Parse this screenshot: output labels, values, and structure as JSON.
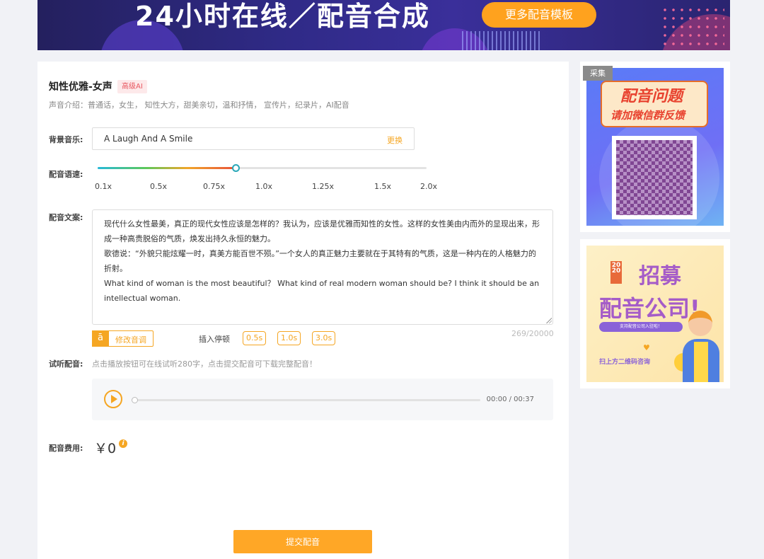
{
  "banner": {
    "title": "24小时在线／配音合成",
    "button": "更多配音模板"
  },
  "voice": {
    "name": "知性优雅-女声",
    "badge": "高级AI",
    "intro": "声音介绍：普通话，女生， 知性大方，甜美亲切，温和抒情， 宣传片，纪录片，AI配音"
  },
  "bgm": {
    "label": "背景音乐:",
    "track": "A Laugh And A Smile",
    "change": "更换"
  },
  "speed": {
    "label": "配音语速:",
    "ticks": [
      "0.1x",
      "0.5x",
      "0.75x",
      "1.0x",
      "1.25x",
      "1.5x",
      "2.0x"
    ],
    "value_fraction": 0.42
  },
  "script": {
    "label": "配音文案:",
    "paragraphs": [
      "现代什么女性最美，真正的现代女性应该是怎样的？我认为，应该是优雅而知性的女性。这样的女性美由内而外的显现出来，形成一种高贵脱俗的气质，焕发出持久永恒的魅力。",
      "歌德说：“外貌只能炫耀一时，真美方能百世不殒。”一个女人的真正魅力主要就在于其特有的气质，这是一种内在的人格魅力的折射。",
      "What kind of woman is the most beautiful？ What kind of real modern woman should be? I think it should be an intellectual woman."
    ],
    "count": "269/20000"
  },
  "tools": {
    "modify_icon": "ā",
    "modify": "修改音调",
    "pause_label": "插入停顿",
    "pauses": [
      "0.5s",
      "1.0s",
      "3.0s"
    ]
  },
  "preview": {
    "label": "试听配音:",
    "note": "点击播放按钮可在线试听280字，点击提交配音可下载完整配音！",
    "time": "00:00 / 00:37",
    "progress_fraction": 0
  },
  "fee": {
    "label": "配音费用:",
    "value": "￥0",
    "info": "i"
  },
  "submit": "提交配音",
  "side": {
    "collect_tag": "采集",
    "poster1_line1": "配音问题",
    "poster1_line2": "请加微信群反馈",
    "poster2_year": "2020",
    "poster2_line1": "招募",
    "poster2_line2": "配音公司!",
    "poster2_pill": "支持配音公司入驻啦！",
    "poster2_line3": "扫上方二维码咨询"
  },
  "colors": {
    "accent": "#f5a623",
    "button": "#ffa726",
    "badge_text": "#e8565f"
  }
}
